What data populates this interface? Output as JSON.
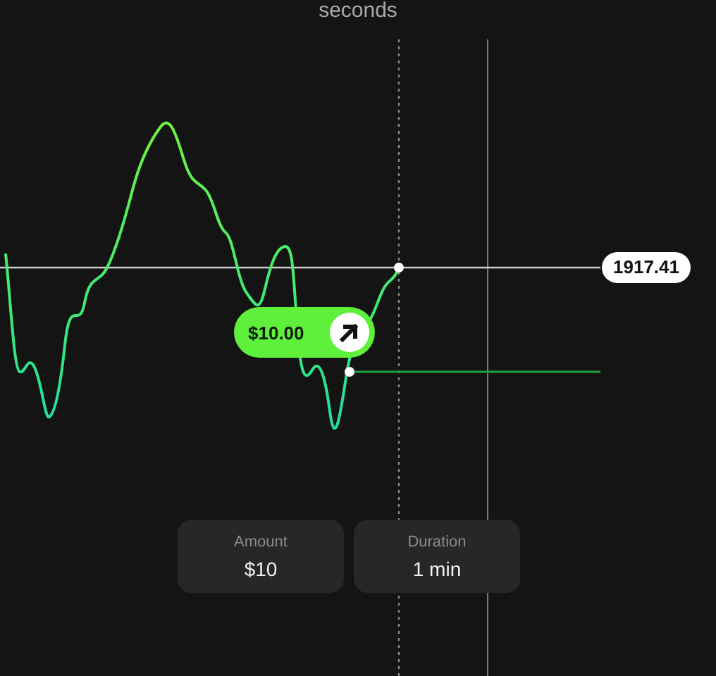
{
  "header": {
    "text": "seconds"
  },
  "price_label": "1917.41",
  "trade": {
    "amount": "$10.00"
  },
  "fields": [
    {
      "label": "Amount",
      "value": "$10"
    },
    {
      "label": "Duration",
      "value": "1 min"
    }
  ]
}
